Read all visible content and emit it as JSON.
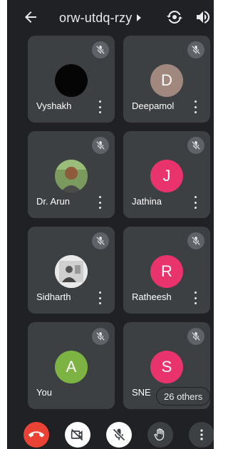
{
  "header": {
    "title": "orw-utdq-rzy",
    "back_icon": "arrow-back-icon",
    "caret_icon": "caret-right-icon",
    "switch_camera_icon": "switch-camera-icon",
    "speaker_icon": "speaker-icon"
  },
  "participants": [
    {
      "name": "Vyshakh",
      "avatar_type": "photo-dark",
      "muted": true
    },
    {
      "name": "Deepamol",
      "initial": "D",
      "avatar_color": "#a1887f",
      "muted": true
    },
    {
      "name": "Dr. Arun",
      "avatar_type": "photo",
      "muted": true
    },
    {
      "name": "Jathina",
      "initial": "J",
      "avatar_color": "#e8336d",
      "muted": true
    },
    {
      "name": "Sidharth",
      "avatar_type": "photo",
      "muted": true
    },
    {
      "name": "Ratheesh",
      "initial": "R",
      "avatar_color": "#e8336d",
      "muted": true
    },
    {
      "name": "You",
      "initial": "A",
      "avatar_color": "#7cb342",
      "muted": true
    },
    {
      "name": "SNE",
      "initial": "S",
      "avatar_color": "#e8336d",
      "muted": true
    }
  ],
  "others": {
    "label": "26 others"
  },
  "controls": {
    "end_call_color": "#ea4335",
    "items": [
      "end-call-icon",
      "camera-off-icon",
      "mic-off-icon",
      "raise-hand-icon",
      "more-vert-icon"
    ]
  }
}
